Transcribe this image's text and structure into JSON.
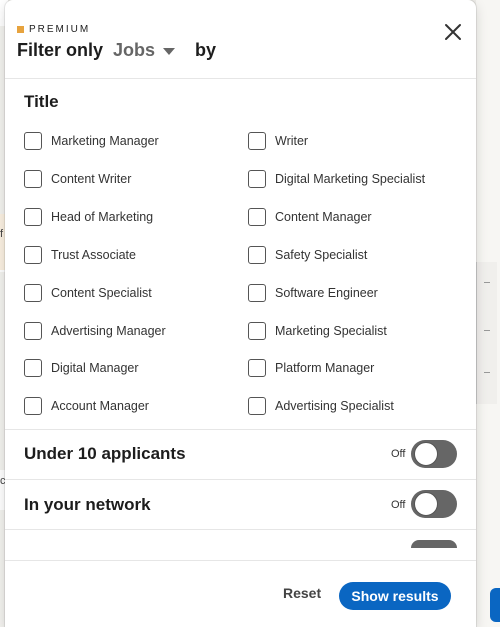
{
  "header": {
    "badge": "PREMIUM",
    "title_prefix": "Filter only",
    "dropdown_value": "Jobs",
    "title_suffix": "by"
  },
  "title_section": {
    "heading": "Title",
    "options_left": [
      "Marketing Manager",
      "Content Writer",
      "Head of Marketing",
      "Trust Associate",
      "Content Specialist",
      "Advertising Manager",
      "Digital Manager",
      "Account Manager"
    ],
    "options_right": [
      "Writer",
      "Digital Marketing Specialist",
      "Content Manager",
      "Safety Specialist",
      "Software Engineer",
      "Marketing Specialist",
      "Platform Manager",
      "Advertising Specialist"
    ]
  },
  "toggles": [
    {
      "label": "Under 10 applicants",
      "state": "Off"
    },
    {
      "label": "In your network",
      "state": "Off"
    }
  ],
  "footer": {
    "reset_label": "Reset",
    "show_label": "Show results"
  },
  "colors": {
    "primary": "#0a66c2",
    "premium_accent": "#e7a33e",
    "toggle_off": "#666666"
  }
}
